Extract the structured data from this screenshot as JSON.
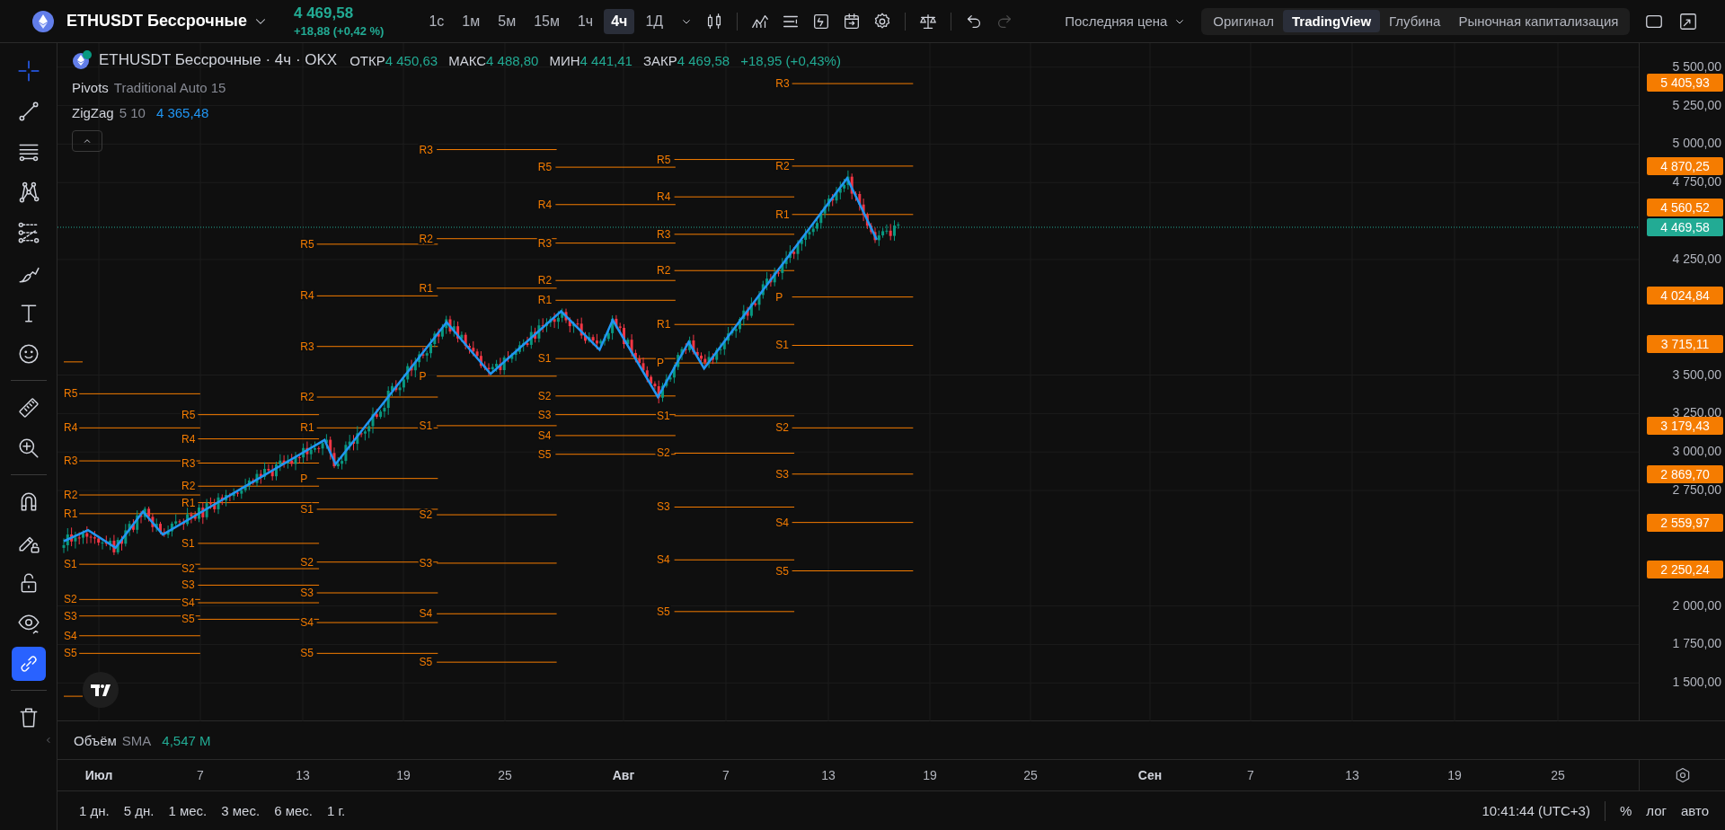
{
  "header": {
    "symbol": "ETHUSDT Бессрочные",
    "last_price": "4 469,58",
    "change": "+18,88 (+0,42 %)",
    "intervals": [
      {
        "label": "1с",
        "selected": false
      },
      {
        "label": "1м",
        "selected": false
      },
      {
        "label": "5м",
        "selected": false
      },
      {
        "label": "15м",
        "selected": false
      },
      {
        "label": "1ч",
        "selected": false
      },
      {
        "label": "4ч",
        "selected": true
      },
      {
        "label": "1Д",
        "selected": false
      }
    ],
    "history": [
      {
        "disabled": false
      },
      {
        "disabled": true
      }
    ],
    "price_source": "Последняя цена",
    "views": [
      {
        "label": "Оригинал",
        "selected": false
      },
      {
        "label": "TradingView",
        "selected": true
      },
      {
        "label": "Глубина",
        "selected": false
      },
      {
        "label": "Рыночная капитализация",
        "selected": false
      }
    ]
  },
  "left_toolbar": {
    "tools": [
      {
        "active": true
      },
      {
        "active": false
      },
      {
        "active": false
      },
      {
        "active": false
      },
      {
        "active": false
      },
      {
        "active": false
      },
      {
        "active": false
      },
      {
        "active": false
      },
      {
        "active": false
      },
      {
        "active": false
      },
      {
        "active": false
      },
      {
        "active": false
      },
      {
        "active": false
      },
      {
        "active": false
      },
      {
        "active": true
      },
      {
        "active": false
      }
    ]
  },
  "legend": {
    "title": "ETHUSDT Бессрочные · 4ч · OKX",
    "ohlc": [
      {
        "label": "ОТКР",
        "value": "4 450,63"
      },
      {
        "label": "МАКС",
        "value": "4 488,80"
      },
      {
        "label": "МИН",
        "value": "4 441,41"
      },
      {
        "label": "ЗАКР",
        "value": "4 469,58"
      }
    ],
    "change": "+18,95 (+0,43%)",
    "indicators": [
      {
        "name": "Pivots",
        "params": "Traditional Auto 15"
      },
      {
        "name": "ZigZag",
        "params": "5 10",
        "value": "4 365,48"
      }
    ]
  },
  "pivots": [
    {
      "labels": [
        "R5",
        "R4",
        "R3",
        "R2",
        "R1",
        "S1",
        "S2",
        "S3",
        "S4",
        "S5"
      ]
    },
    {
      "labels": [
        "R5",
        "R4",
        "R3",
        "R2",
        "R1",
        "S1",
        "S2",
        "S3",
        "S4",
        "S5"
      ]
    },
    {
      "labels": [
        "R5",
        "R4",
        "R3",
        "R2",
        "R1",
        "P",
        "S1",
        "S2",
        "S3",
        "S4",
        "S5"
      ]
    },
    {
      "labels": [
        "R3",
        "R2",
        "R1",
        "P",
        "S1",
        "S2",
        "S3",
        "S4",
        "S5"
      ]
    },
    {
      "labels": [
        "R5",
        "R4",
        "R3",
        "R2",
        "R1",
        "S1",
        "S2",
        "S3",
        "S4",
        "S5"
      ]
    },
    {
      "labels": [
        "R5",
        "R4",
        "R3",
        "R2",
        "R1",
        "P",
        "S1",
        "S2",
        "S3",
        "S4",
        "S5"
      ]
    },
    {
      "labels": [
        "R3",
        "R2",
        "R1",
        "P",
        "S1",
        "S2",
        "S3",
        "S4",
        "S5"
      ]
    }
  ],
  "price_axis": {
    "ticks": [
      "5 500,00",
      "5 250,00",
      "5 000,00",
      "4 750,00",
      "4 250,00",
      "3 500,00",
      "3 250,00",
      "3 000,00",
      "2 750,00",
      "2 000,00",
      "1 750,00",
      "1 500,00"
    ],
    "markers": [
      {
        "price": "5 405,93",
        "kind": "pivot"
      },
      {
        "price": "4 870,25",
        "kind": "pivot"
      },
      {
        "price": "4 560,52",
        "kind": "pivot"
      },
      {
        "price": "4 469,58",
        "kind": "last"
      },
      {
        "price": "4 024,84",
        "kind": "pivot"
      },
      {
        "price": "3 715,11",
        "kind": "pivot"
      },
      {
        "price": "3 179,43",
        "kind": "pivot"
      },
      {
        "price": "2 869,70",
        "kind": "pivot"
      },
      {
        "price": "2 559,97",
        "kind": "pivot"
      },
      {
        "price": "2 250,24",
        "kind": "pivot"
      }
    ]
  },
  "volume": {
    "label": "Объём",
    "ma": "SMA",
    "value": "4,547 M"
  },
  "time_axis": {
    "labels": [
      {
        "text": "Июл",
        "kind": "month"
      },
      {
        "text": "7",
        "kind": "day"
      },
      {
        "text": "13",
        "kind": "day"
      },
      {
        "text": "19",
        "kind": "day"
      },
      {
        "text": "25",
        "kind": "day"
      },
      {
        "text": "Авг",
        "kind": "month"
      },
      {
        "text": "7",
        "kind": "day"
      },
      {
        "text": "13",
        "kind": "day"
      },
      {
        "text": "19",
        "kind": "day"
      },
      {
        "text": "25",
        "kind": "day"
      },
      {
        "text": "Сен",
        "kind": "month"
      },
      {
        "text": "7",
        "kind": "day"
      },
      {
        "text": "13",
        "kind": "day"
      },
      {
        "text": "19",
        "kind": "day"
      },
      {
        "text": "25",
        "kind": "day"
      }
    ]
  },
  "bottom_bar": {
    "ranges": [
      "1 дн.",
      "5 дн.",
      "1 мес.",
      "3 мес.",
      "6 мес.",
      "1 г."
    ],
    "clock": "10:41:44 (UTC+3)",
    "options": [
      "%",
      "лог",
      "авто"
    ]
  }
}
